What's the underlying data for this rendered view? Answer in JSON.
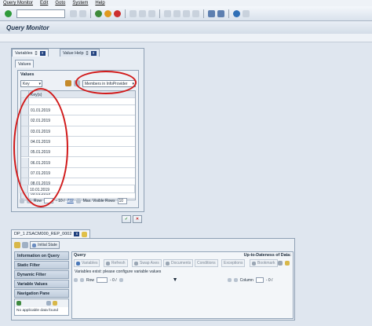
{
  "menu": {
    "items": [
      "Query Monitor",
      "Edit",
      "Goto",
      "System",
      "Help"
    ]
  },
  "window": {
    "title": "Query Monitor"
  },
  "tabs": [
    {
      "label": "Variables",
      "extra": "[]"
    },
    {
      "label": "Value Help",
      "extra": "[]"
    }
  ],
  "values_tab": {
    "label": "Values"
  },
  "values_group": {
    "title": "Values",
    "key_dropdown": "Key",
    "source_dropdown": "Members in InfoProvider",
    "column_header": "Key(s)",
    "rows": [
      "01.01.2019",
      "02.01.2019",
      "03.01.2019",
      "04.01.2019",
      "05.01.2019",
      "06.01.2019",
      "07.01.2019",
      "08.01.2019",
      "09.01.2019",
      "10.01.2019"
    ],
    "footer": {
      "row_label": "Row",
      "page_info": "- 10 /",
      "page_total": "732",
      "max_rows_label": "Max. Visible Rows",
      "max_rows_value": "10"
    }
  },
  "dp_tab": {
    "label": "DP_1 ZSACM000_REP_0002"
  },
  "initial_state_button": "Initial State",
  "left_nav": [
    "Information on Query",
    "Static Filter",
    "Dynamic Filter",
    "Variable Values",
    "Navigation Pane"
  ],
  "no_data_text": "No applicable data found",
  "query_panel": {
    "title": "Query",
    "uptodate": "Up-to-Dateness of Data:",
    "buttons": [
      "Variables",
      "Refresh",
      "Swap Axes",
      "Documents",
      "Conditions",
      "Exceptions",
      "Bookmark"
    ],
    "message": "Variables exist: please configure variable values",
    "row_label": "Row",
    "row_info": "- 0 /",
    "column_label": "Column",
    "column_info": "- 0 /"
  },
  "colors": {
    "annotation": "#d11a1a",
    "accent": "#1e3f7d"
  }
}
